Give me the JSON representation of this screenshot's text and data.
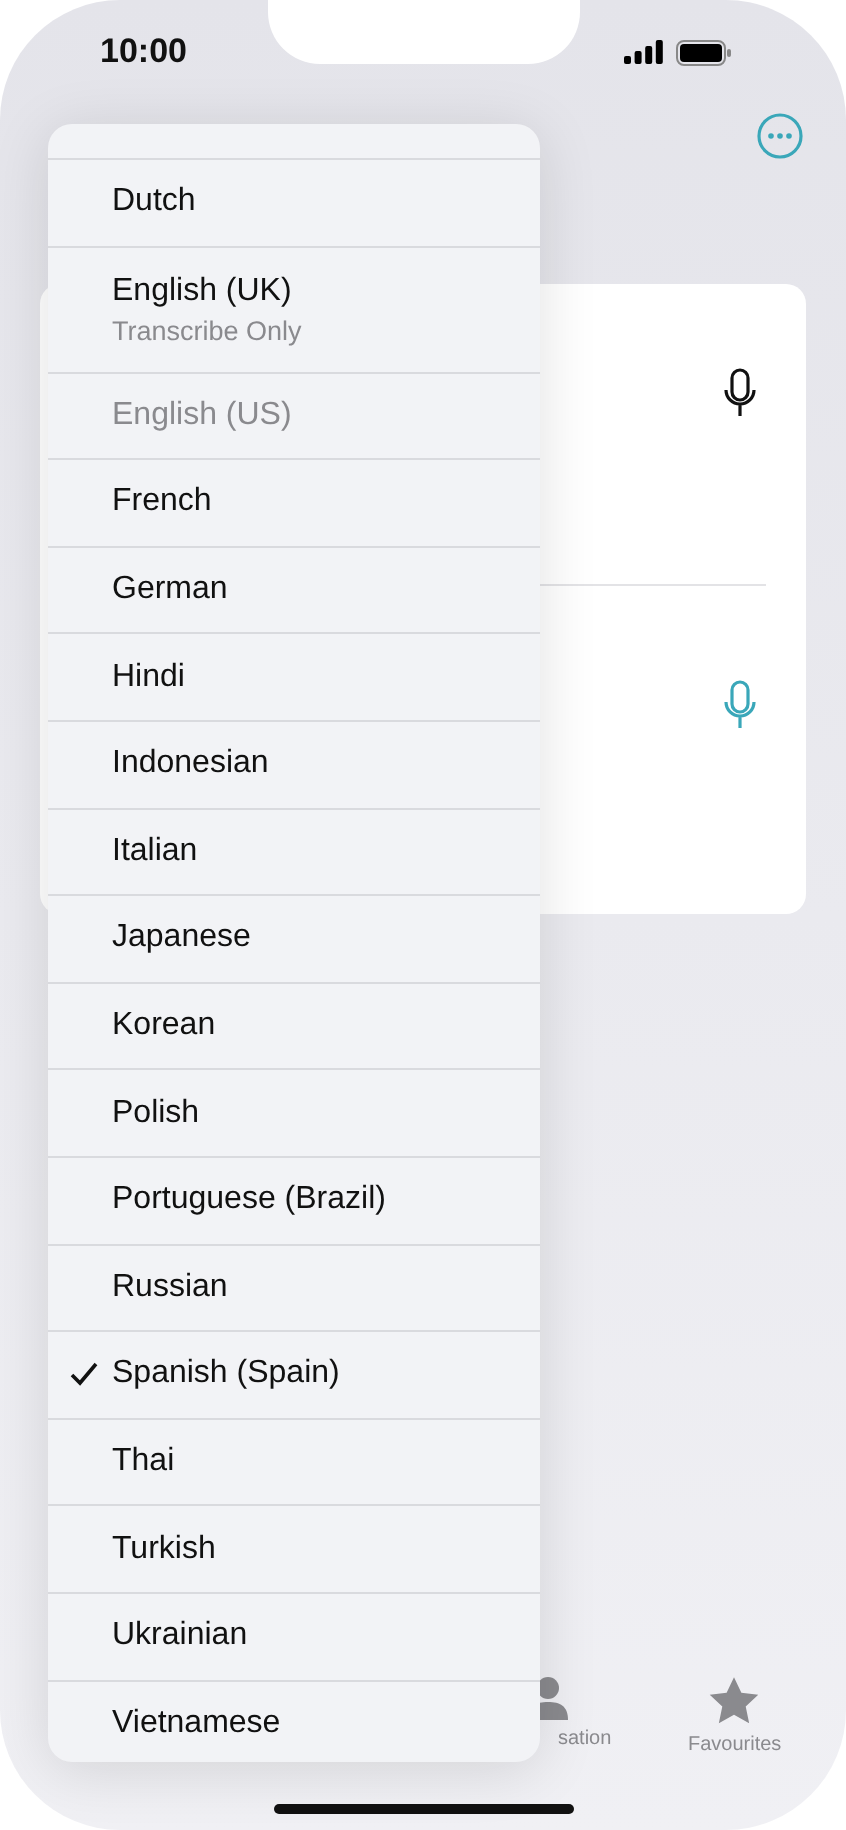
{
  "status_bar": {
    "time": "10:00"
  },
  "menu": {
    "items": [
      {
        "label": "Dutch",
        "checked": false,
        "disabled": false
      },
      {
        "label": "English (UK)",
        "subtitle": "Transcribe Only",
        "checked": false,
        "disabled": false
      },
      {
        "label": "English (US)",
        "checked": false,
        "disabled": true
      },
      {
        "label": "French",
        "checked": false,
        "disabled": false
      },
      {
        "label": "German",
        "checked": false,
        "disabled": false
      },
      {
        "label": "Hindi",
        "checked": false,
        "disabled": false
      },
      {
        "label": "Indonesian",
        "checked": false,
        "disabled": false
      },
      {
        "label": "Italian",
        "checked": false,
        "disabled": false
      },
      {
        "label": "Japanese",
        "checked": false,
        "disabled": false
      },
      {
        "label": "Korean",
        "checked": false,
        "disabled": false
      },
      {
        "label": "Polish",
        "checked": false,
        "disabled": false
      },
      {
        "label": "Portuguese (Brazil)",
        "checked": false,
        "disabled": false
      },
      {
        "label": "Russian",
        "checked": false,
        "disabled": false
      },
      {
        "label": "Spanish (Spain)",
        "checked": true,
        "disabled": false
      },
      {
        "label": "Thai",
        "checked": false,
        "disabled": false
      },
      {
        "label": "Turkish",
        "checked": false,
        "disabled": false
      },
      {
        "label": "Ukrainian",
        "checked": false,
        "disabled": false
      },
      {
        "label": "Vietnamese",
        "checked": false,
        "disabled": false
      }
    ]
  },
  "tab_bar": {
    "items": [
      {
        "label": "sation"
      },
      {
        "label": "Favourites"
      }
    ]
  }
}
